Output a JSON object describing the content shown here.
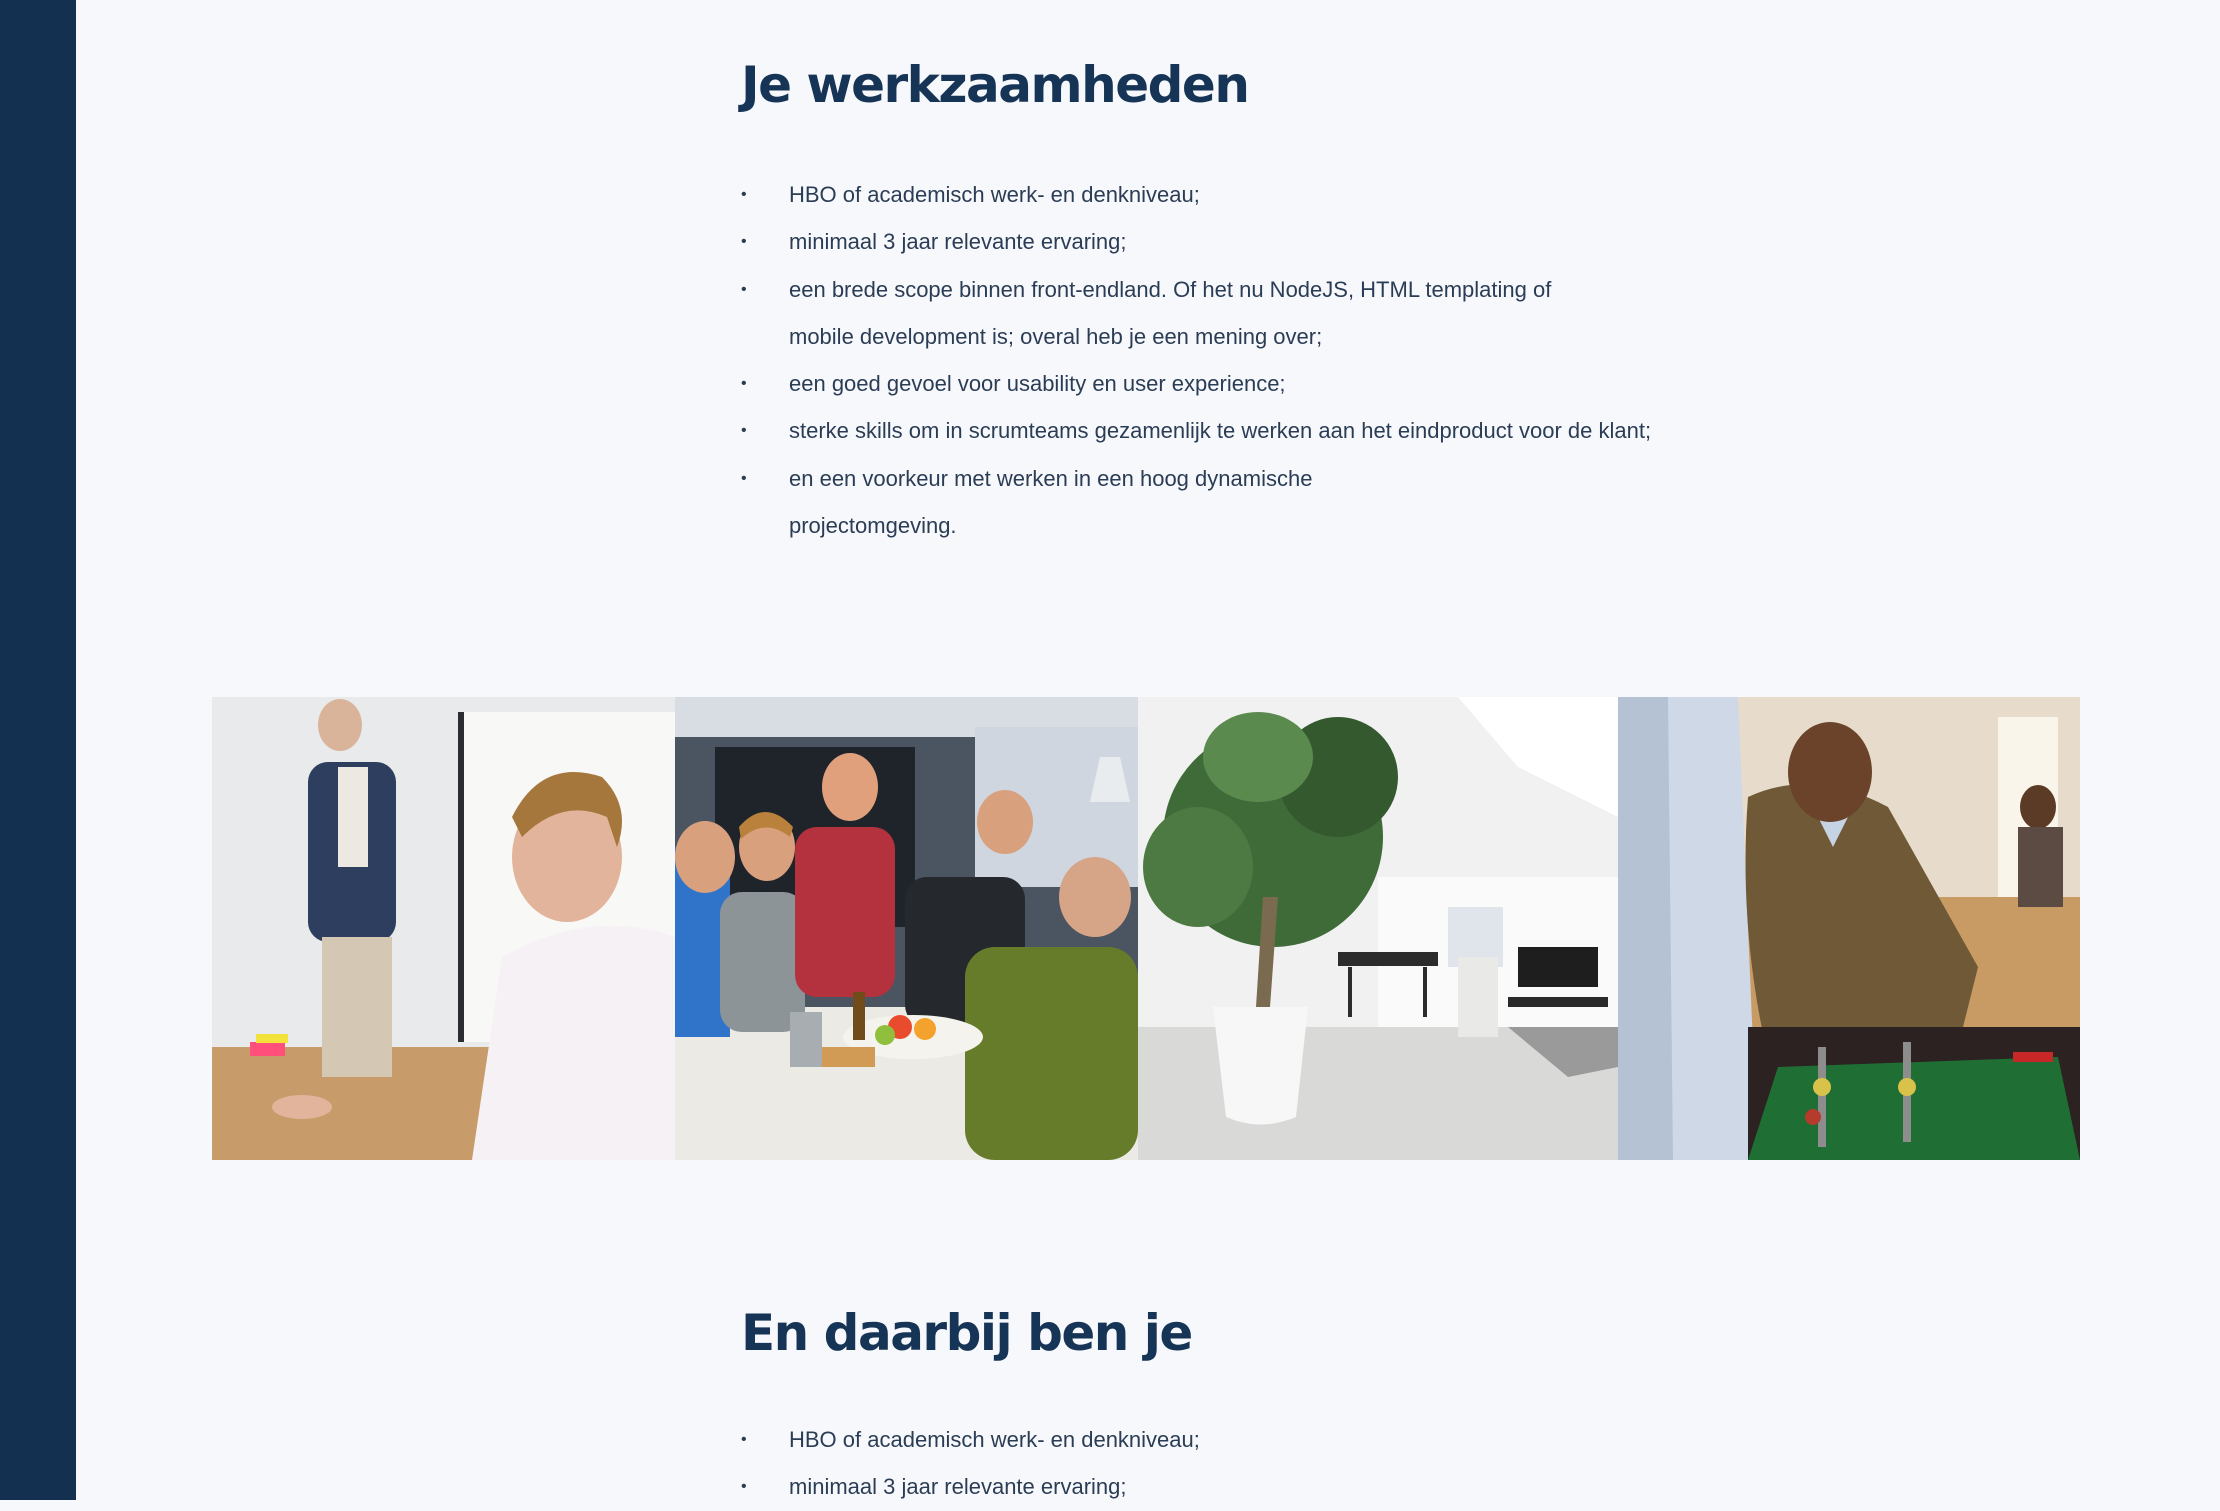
{
  "colors": {
    "sidebar": "#143050",
    "heading": "#163455",
    "text": "#2b3d55",
    "background": "#f7f8fc"
  },
  "section1": {
    "title": "Je werkzaamheden",
    "bullet_icon": "•",
    "items": [
      "HBO of academisch werk- en denkniveau;",
      "minimaal 3 jaar relevante ervaring;",
      "een brede scope binnen front-endland. Of het nu NodeJS, HTML templating of mobile development is; overal heb je een mening over;",
      "een goed gevoel voor usability en user experience;",
      "sterke skills om in scrumteams gezamenlijk te werken aan het eindproduct voor de klant;",
      "en een voorkeur met werken in een hoog dynamische projectomgeving."
    ]
  },
  "gallery": {
    "photos": [
      {
        "subject": "presentation-meeting-photo"
      },
      {
        "subject": "team-drinks-photo"
      },
      {
        "subject": "office-plant-photo"
      },
      {
        "subject": "foosball-photo"
      }
    ]
  },
  "section2": {
    "title": "En daarbij ben je",
    "bullet_icon": "•",
    "items": [
      "HBO of academisch werk- en denkniveau;",
      "minimaal 3 jaar relevante ervaring;"
    ]
  }
}
